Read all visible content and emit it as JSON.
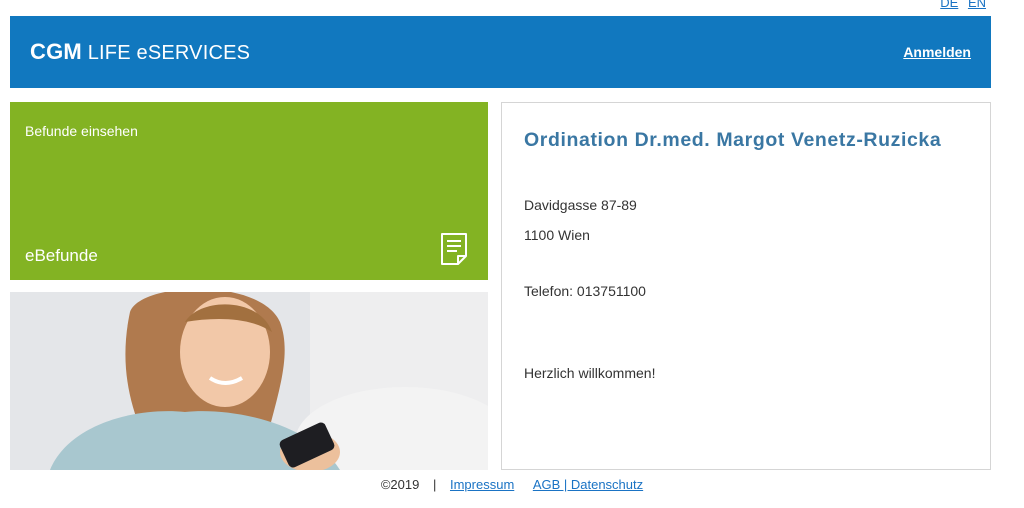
{
  "lang": {
    "de": "DE",
    "en": "EN"
  },
  "header": {
    "brand_bold": "CGM",
    "brand_rest": "LIFE eSERVICES",
    "login": "Anmelden"
  },
  "tile": {
    "subtitle": "Befunde einsehen",
    "title": "eBefunde",
    "icon": "document-icon"
  },
  "info": {
    "title": "Ordination Dr.med. Margot Venetz-Ruzicka",
    "street": "Davidgasse 87-89",
    "city": "1100 Wien",
    "phone": "Telefon: 013751100",
    "welcome": "Herzlich willkommen!"
  },
  "footer": {
    "copyright": "©2019",
    "separator": "|",
    "impressum": "Impressum",
    "agb": "AGB | Datenschutz"
  },
  "colors": {
    "header": "#1178bf",
    "tile": "#83b323",
    "title": "#3a77a3",
    "link": "#1a73c4"
  }
}
